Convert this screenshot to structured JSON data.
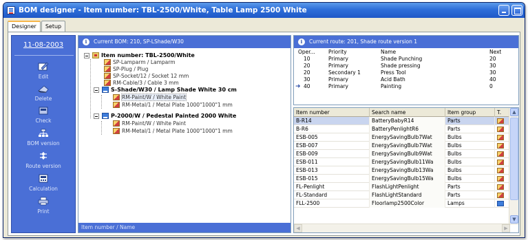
{
  "window": {
    "title": "BOM designer - Item number: TBL-2500/White, Table Lamp 2500 White"
  },
  "tabs": [
    {
      "label": "Designer",
      "active": true
    },
    {
      "label": "Setup",
      "active": false
    }
  ],
  "sidebar": {
    "date": "11-08-2003",
    "items": [
      {
        "label": "Edit",
        "icon": "edit-icon"
      },
      {
        "label": "Delete",
        "icon": "delete-icon"
      },
      {
        "label": "Check",
        "icon": "check-icon"
      },
      {
        "label": "BOM version",
        "icon": "bom-version-icon"
      },
      {
        "label": "Route version",
        "icon": "route-version-icon"
      },
      {
        "label": "Calculation",
        "icon": "calculator-icon"
      },
      {
        "label": "Print",
        "icon": "printer-icon"
      }
    ]
  },
  "bom_panel": {
    "header": "Current BOM: 210, SP-LShade/W30",
    "footer": "Item number / Name",
    "tree": [
      {
        "label": "Item number: TBL-2500/White",
        "bold": true,
        "icon": "folder"
      },
      {
        "label": "SP-Lamparm / Lamparm",
        "icon": "part"
      },
      {
        "label": "SP-Plug / Plug",
        "icon": "part"
      },
      {
        "label": "SP-Socket/12 / Socket 12 mm",
        "icon": "part"
      },
      {
        "label": "RM-Cable/3 / Cable 3 mm",
        "icon": "part"
      },
      {
        "label": "S-Shade/W30 / Lamp Shade White 30 cm",
        "bold": true,
        "icon": "sub"
      },
      {
        "label": "RM-Paint/W / White Paint",
        "icon": "part",
        "selected": true
      },
      {
        "label": "RM-Metal/1 / Metal Plate 1000\"1000\"1 mm",
        "icon": "part"
      },
      {
        "label": "P-2000/W / Pedestal Painted 2000 White",
        "bold": true,
        "icon": "sub"
      },
      {
        "label": "RM-Paint/W / White Paint",
        "icon": "part"
      },
      {
        "label": "RM-Metal/1 / Metal Plate 1000\"1000\"1 mm",
        "icon": "part"
      }
    ]
  },
  "route_panel": {
    "header": "Current route: 201, Shade route version 1",
    "columns": [
      "Oper...",
      "Priority",
      "Name",
      "Next"
    ],
    "rows": [
      {
        "oper": "10",
        "priority": "Primary",
        "name": "Shade Punching",
        "next": "20"
      },
      {
        "oper": "20",
        "priority": "Primary",
        "name": "Shade pressing",
        "next": "30"
      },
      {
        "oper": "20",
        "priority": "Secondary 1",
        "name": "Press Tool",
        "next": "30"
      },
      {
        "oper": "30",
        "priority": "Primary",
        "name": "Acid Bath",
        "next": "40"
      },
      {
        "oper": "40",
        "priority": "Primary",
        "name": "Painting",
        "next": "0",
        "current": true
      }
    ]
  },
  "items_grid": {
    "columns": [
      "Item number",
      "Search name",
      "Item group",
      "T."
    ],
    "rows": [
      {
        "item": "B-R14",
        "search": "BatteryBabyR14",
        "group": "Parts",
        "type": "part",
        "selected": true
      },
      {
        "item": "B-R6",
        "search": "BatteryPenlightR6",
        "group": "Parts",
        "type": "part"
      },
      {
        "item": "ESB-005",
        "search": "EnergySavingBulb7Wat",
        "group": "Bulbs",
        "type": "part"
      },
      {
        "item": "ESB-007",
        "search": "EnergySavingBulb7Wat",
        "group": "Bulbs",
        "type": "part"
      },
      {
        "item": "ESB-009",
        "search": "EnergySavingBulb9Wat",
        "group": "Bulbs",
        "type": "part"
      },
      {
        "item": "ESB-011",
        "search": "EnergySavingBulb11Wa",
        "group": "Bulbs",
        "type": "part"
      },
      {
        "item": "ESB-013",
        "search": "EnergySavingBulb13Wa",
        "group": "Bulbs",
        "type": "part"
      },
      {
        "item": "ESB-015",
        "search": "EnergySavingBulb15Wa",
        "group": "Bulbs",
        "type": "part"
      },
      {
        "item": "FL-Penlight",
        "search": "FlashLightPenlight",
        "group": "Parts",
        "type": "part"
      },
      {
        "item": "FL-Standard",
        "search": "FlashLightStandard",
        "group": "Parts",
        "type": "part"
      },
      {
        "item": "FLL-2500",
        "search": "Floorlamp2500Color",
        "group": "Lamps",
        "type": "lamp"
      }
    ]
  }
}
